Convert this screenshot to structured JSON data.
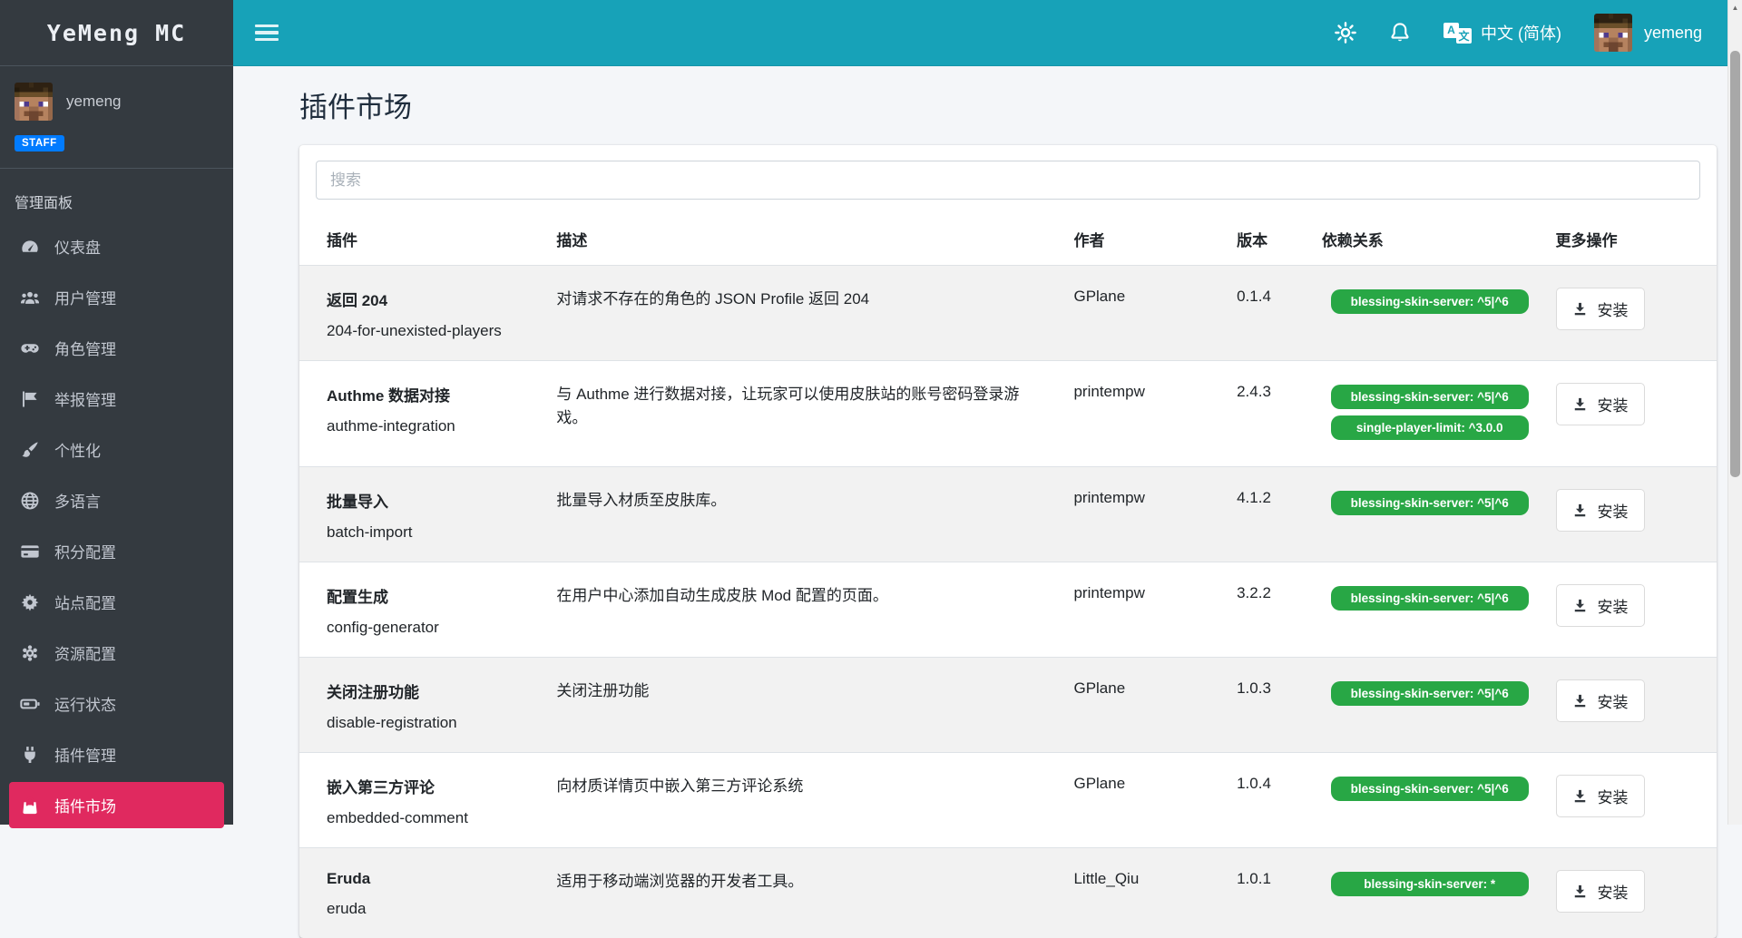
{
  "brand": "YeMeng MC",
  "colors": {
    "navbar_teal": "#17a2b8",
    "sidebar_dark": "#343a40",
    "active_pink": "#e0295f",
    "staff_blue": "#007bff",
    "badge_green": "#28a745",
    "content_bg": "#f4f6f9"
  },
  "sidebar": {
    "user": {
      "name": "yemeng",
      "badge": "STAFF"
    },
    "section_label": "管理面板",
    "items": [
      {
        "label": "仪表盘",
        "icon": "tachometer"
      },
      {
        "label": "用户管理",
        "icon": "users"
      },
      {
        "label": "角色管理",
        "icon": "gamepad"
      },
      {
        "label": "举报管理",
        "icon": "flag"
      },
      {
        "label": "个性化",
        "icon": "paint-brush"
      },
      {
        "label": "多语言",
        "icon": "globe"
      },
      {
        "label": "积分配置",
        "icon": "credit-card"
      },
      {
        "label": "站点配置",
        "icon": "cog"
      },
      {
        "label": "资源配置",
        "icon": "gear"
      },
      {
        "label": "运行状态",
        "icon": "battery"
      },
      {
        "label": "插件管理",
        "icon": "plug"
      },
      {
        "label": "插件市场",
        "icon": "shopping-bag",
        "active": true
      }
    ]
  },
  "navbar": {
    "language": "中文 (简体)",
    "username": "yemeng"
  },
  "page": {
    "title": "插件市场",
    "search_placeholder": "搜索"
  },
  "table": {
    "headers": [
      "插件",
      "描述",
      "作者",
      "版本",
      "依赖关系",
      "更多操作"
    ],
    "install_label": "安装",
    "rows": [
      {
        "name": "返回 204",
        "id": "204-for-unexisted-players",
        "description": "对请求不存在的角色的 JSON Profile 返回 204",
        "author": "GPlane",
        "version": "0.1.4",
        "dependencies": [
          "blessing-skin-server: ^5|^6"
        ]
      },
      {
        "name": "Authme 数据对接",
        "id": "authme-integration",
        "description": "与 Authme 进行数据对接，让玩家可以使用皮肤站的账号密码登录游戏。",
        "author": "printempw",
        "version": "2.4.3",
        "dependencies": [
          "blessing-skin-server: ^5|^6",
          "single-player-limit: ^3.0.0"
        ]
      },
      {
        "name": "批量导入",
        "id": "batch-import",
        "description": "批量导入材质至皮肤库。",
        "author": "printempw",
        "version": "4.1.2",
        "dependencies": [
          "blessing-skin-server: ^5|^6"
        ]
      },
      {
        "name": "配置生成",
        "id": "config-generator",
        "description": "在用户中心添加自动生成皮肤 Mod 配置的页面。",
        "author": "printempw",
        "version": "3.2.2",
        "dependencies": [
          "blessing-skin-server: ^5|^6"
        ]
      },
      {
        "name": "关闭注册功能",
        "id": "disable-registration",
        "description": "关闭注册功能",
        "author": "GPlane",
        "version": "1.0.3",
        "dependencies": [
          "blessing-skin-server: ^5|^6"
        ]
      },
      {
        "name": "嵌入第三方评论",
        "id": "embedded-comment",
        "description": "向材质详情页中嵌入第三方评论系统",
        "author": "GPlane",
        "version": "1.0.4",
        "dependencies": [
          "blessing-skin-server: ^5|^6"
        ]
      },
      {
        "name": "Eruda",
        "id": "eruda",
        "description": "适用于移动端浏览器的开发者工具。",
        "author": "Little_Qiu",
        "version": "1.0.1",
        "dependencies": [
          "blessing-skin-server: *"
        ]
      }
    ]
  }
}
